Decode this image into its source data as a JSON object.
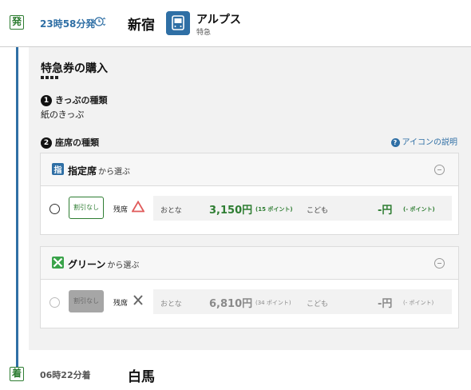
{
  "header": {
    "dep_badge": "発",
    "dep_time": "23時58分発",
    "dep_station": "新宿",
    "train_name": "アルプス",
    "train_type": "特急"
  },
  "main": {
    "section_title": "特急券の購入",
    "step1": {
      "num": "1",
      "label": "きっぷの種類",
      "value": "紙のきっぷ"
    },
    "step2": {
      "num": "2",
      "label": "座席の種類"
    },
    "help_link": "アイコンの説明"
  },
  "cards": [
    {
      "icon_text": "指",
      "title": "指定席",
      "suffix": "から選ぶ",
      "discount": "割引なし",
      "seat_label": "残席",
      "availability": "few (triangle)",
      "adult_label": "おとな",
      "adult_price": "3,150円",
      "adult_points": "(15 ポイント)",
      "child_label": "こども",
      "child_price": "-円",
      "child_points": "(- ポイント)",
      "enabled": true
    },
    {
      "icon_text": "",
      "title": "グリーン",
      "suffix": "から選ぶ",
      "discount": "割引なし",
      "seat_label": "残席",
      "availability": "none (cross)",
      "adult_label": "おとな",
      "adult_price": "6,810円",
      "adult_points": "(34 ポイント)",
      "child_label": "こども",
      "child_price": "-円",
      "child_points": "(- ポイント)",
      "enabled": false
    }
  ],
  "arrival": {
    "arr_badge": "着",
    "arr_time": "06時22分着",
    "arr_station": "白馬"
  },
  "colors": {
    "accent_blue": "#2f6fa5",
    "green": "#2e7d32",
    "warning_red": "#e05a5a"
  }
}
